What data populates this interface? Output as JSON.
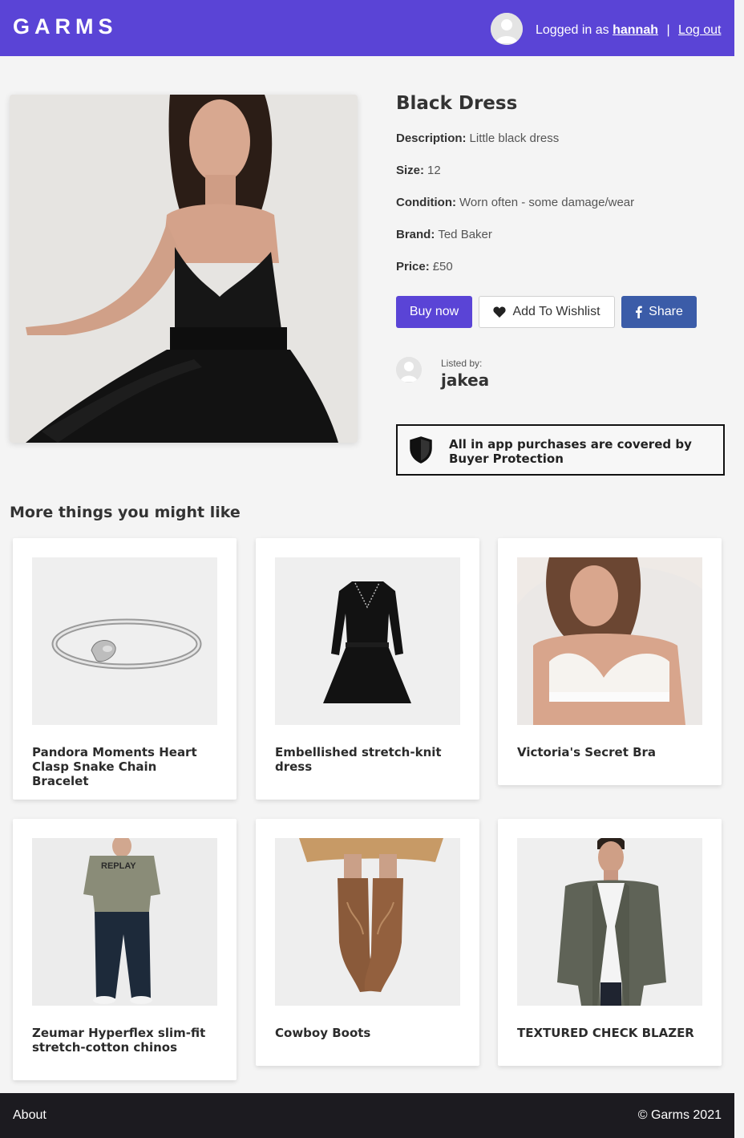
{
  "header": {
    "logo": "GARMS",
    "logged_in_prefix": "Logged in as",
    "username": "hannah",
    "separator": "|",
    "logout_label": "Log out"
  },
  "product": {
    "title": "Black Dress",
    "fields": {
      "description_label": "Description:",
      "description": "Little black dress",
      "size_label": "Size:",
      "size": "12",
      "condition_label": "Condition:",
      "condition": "Worn often - some damage/wear",
      "brand_label": "Brand:",
      "brand": "Ted Baker",
      "price_label": "Price:",
      "price": "£50"
    },
    "actions": {
      "buy_label": "Buy now",
      "wishlist_label": "Add To Wishlist",
      "share_label": "Share"
    },
    "seller": {
      "listed_by_label": "Listed by:",
      "name": "jakea"
    },
    "protection_text": "All in app purchases are covered by Buyer Protection"
  },
  "recommendations": {
    "heading": "More things you might like",
    "items": [
      {
        "title": "Pandora Moments Heart Clasp Snake Chain Bracelet"
      },
      {
        "title": "Embellished stretch-knit dress"
      },
      {
        "title": "Victoria's Secret Bra"
      },
      {
        "title": "Zeumar Hyperflex slim-fit stretch-cotton chinos"
      },
      {
        "title": "Cowboy Boots"
      },
      {
        "title": "TEXTURED CHECK BLAZER"
      }
    ]
  },
  "footer": {
    "about_label": "About",
    "copyright": "© Garms 2021"
  },
  "colors": {
    "brand": "#5a44d6",
    "share": "#3b5ca8",
    "footer": "#1c1b20",
    "background": "#f4f4f4"
  }
}
